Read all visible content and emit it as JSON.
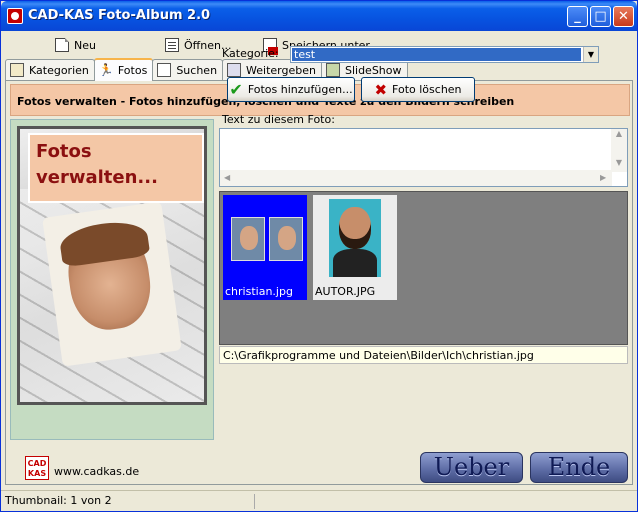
{
  "window": {
    "title": "CAD-KAS Foto-Album 2.0",
    "min": "_",
    "max": "□",
    "close": "✕"
  },
  "toolbar": {
    "new": "Neu",
    "open": "Öffnen...",
    "save_as": "Speichern unter..."
  },
  "tabs": [
    {
      "label": "Kategorien"
    },
    {
      "label": "Fotos"
    },
    {
      "label": "Suchen"
    },
    {
      "label": "Weitergeben"
    },
    {
      "label": "SlideShow"
    }
  ],
  "banner": "Fotos verwalten - Fotos hinzufügen, löschen und Texte zu den Bildern schreiben",
  "picture": {
    "headline_line1": "Fotos",
    "headline_line2": "verwalten..."
  },
  "form": {
    "category_label": "Kategorie:",
    "category_value": "test",
    "add_button": "Fotos hinzufügen...",
    "delete_button": "Foto löschen",
    "text_label": "Text zu diesem Foto:",
    "text_value": ""
  },
  "thumbnails": [
    {
      "name": "christian.jpg",
      "selected": true
    },
    {
      "name": "AUTOR.JPG",
      "selected": false
    }
  ],
  "path": "C:\\Grafikprogramme und Dateien\\Bilder\\Ich\\christian.jpg",
  "footer": {
    "logo": "CAD KAS",
    "url": "www.cadkas.de",
    "ueber": "Ueber",
    "ende": "Ende"
  },
  "status": {
    "left": "Thumbnail: 1 von 2",
    "right": ""
  }
}
